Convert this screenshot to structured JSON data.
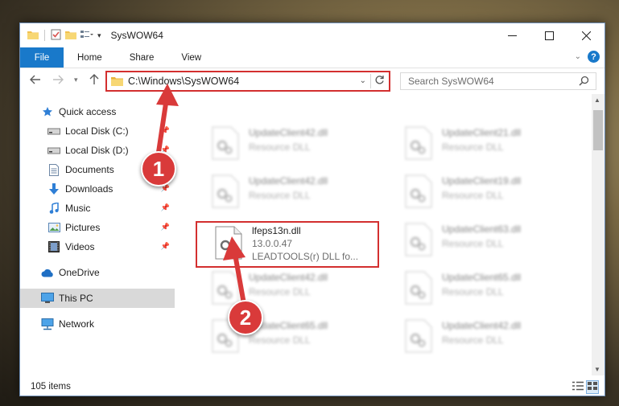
{
  "window": {
    "title": "SysWOW64"
  },
  "ribbon": {
    "file": "File",
    "tabs": [
      "Home",
      "Share",
      "View"
    ],
    "help": "?"
  },
  "nav": {
    "address": "C:\\Windows\\SysWOW64",
    "search_placeholder": "Search SysWOW64"
  },
  "sidebar": {
    "items": [
      {
        "label": "Quick access",
        "icon": "star-icon"
      },
      {
        "label": "Local Disk (C:)",
        "icon": "drive-icon",
        "pinned": true
      },
      {
        "label": "Local Disk (D:)",
        "icon": "drive-icon",
        "pinned": true
      },
      {
        "label": "Documents",
        "icon": "documents-icon",
        "pinned": true
      },
      {
        "label": "Downloads",
        "icon": "download-arrow-icon",
        "pinned": true
      },
      {
        "label": "Music",
        "icon": "music-note-icon",
        "pinned": true
      },
      {
        "label": "Pictures",
        "icon": "pictures-icon",
        "pinned": true
      },
      {
        "label": "Videos",
        "icon": "videos-icon",
        "pinned": true
      },
      {
        "label": "OneDrive",
        "icon": "cloud-icon"
      },
      {
        "label": "This PC",
        "icon": "monitor-icon",
        "selected": true
      },
      {
        "label": "Network",
        "icon": "network-icon"
      }
    ]
  },
  "files": [
    {
      "name": "UpdateClient42.dll",
      "type": "Resource DLL"
    },
    {
      "name": "UpdateClient21.dll",
      "type": "Resource DLL"
    },
    {
      "name": "UpdateClient42.dll",
      "type": "Resource DLL"
    },
    {
      "name": "UpdateClient19.dll",
      "type": "Resource DLL"
    },
    {
      "name": "lfeps13n.dll",
      "version": "13.0.0.47",
      "description": "LEADTOOLS(r) DLL fo..."
    },
    {
      "name": "UpdateClient63.dll",
      "type": "Resource DLL"
    },
    {
      "name": "UpdateClient42.dll",
      "type": "Resource DLL"
    },
    {
      "name": "UpdateClient65.dll",
      "type": "Resource DLL"
    },
    {
      "name": "UpdateClient65.dll",
      "type": "Resource DLL"
    },
    {
      "name": "UpdateClient42.dll",
      "type": "Resource DLL"
    }
  ],
  "status": {
    "items_count": "105 items"
  },
  "callouts": [
    "1",
    "2"
  ],
  "colors": {
    "accent": "#1979ca",
    "highlight": "#d32f2f",
    "callout": "#d93a3a",
    "folder": "#f2c14e"
  }
}
